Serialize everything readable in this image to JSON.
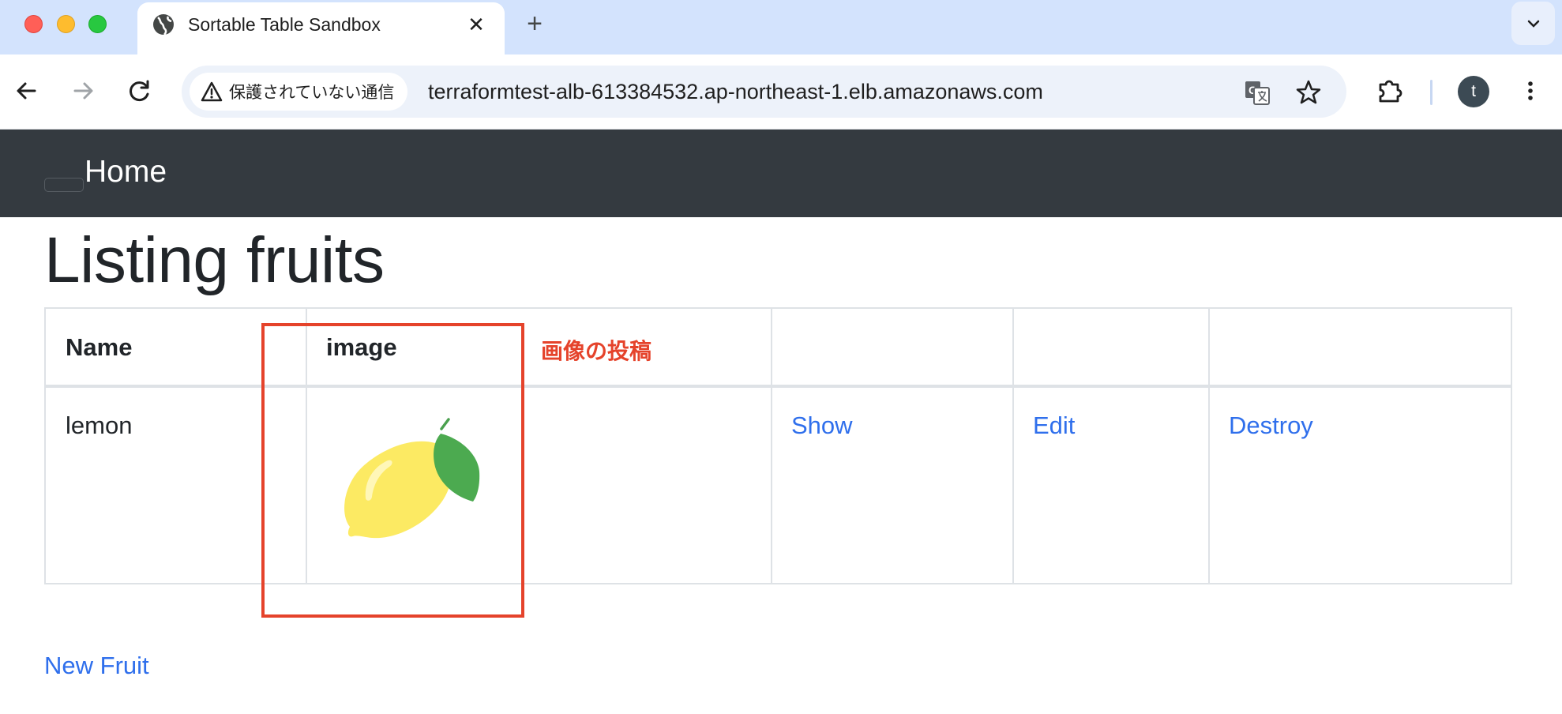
{
  "browser": {
    "tab_title": "Sortable Table Sandbox",
    "tab_close": "✕",
    "new_tab": "+",
    "security_chip": "保護されていない通信",
    "url": "terraformtest-alb-613384532.ap-northeast-1.elb.amazonaws.com",
    "profile_initial": "t"
  },
  "navbar": {
    "brand": "Home"
  },
  "page": {
    "title": "Listing fruits",
    "new_link": "New Fruit"
  },
  "table": {
    "headers": [
      "Name",
      "image",
      "",
      "",
      "",
      ""
    ],
    "rows": [
      {
        "name": "lemon",
        "image_icon": "lemon-image",
        "show": "Show",
        "edit": "Edit",
        "destroy": "Destroy"
      }
    ]
  },
  "annotation": {
    "label": "画像の投稿",
    "color": "#e5432b"
  },
  "colors": {
    "navbar_bg": "#343a40",
    "link": "#2f6fec",
    "tabstrip_bg": "#d3e3fd"
  }
}
